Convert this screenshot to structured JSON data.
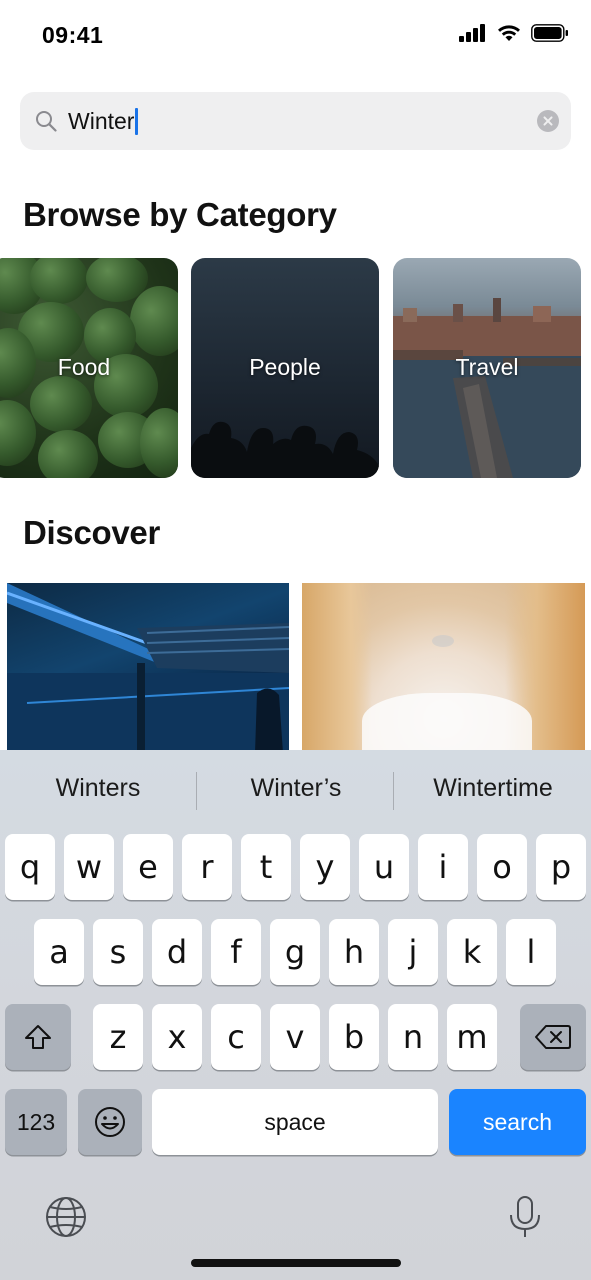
{
  "status_bar": {
    "time": "09:41",
    "icons": [
      "cellular-signal-icon",
      "wifi-icon",
      "battery-icon"
    ]
  },
  "search": {
    "value": "Winter",
    "icon": "search-icon",
    "clear_icon": "clear-icon"
  },
  "browse": {
    "title": "Browse by Category",
    "categories": [
      {
        "label": "Food"
      },
      {
        "label": "People"
      },
      {
        "label": "Travel"
      }
    ]
  },
  "discover": {
    "title": "Discover"
  },
  "keyboard": {
    "suggestions": [
      "Winters",
      "Winter’s",
      "Wintertime"
    ],
    "row1": [
      "q",
      "w",
      "e",
      "r",
      "t",
      "y",
      "u",
      "i",
      "o",
      "p"
    ],
    "row2": [
      "a",
      "s",
      "d",
      "f",
      "g",
      "h",
      "j",
      "k",
      "l"
    ],
    "row3": [
      "z",
      "x",
      "c",
      "v",
      "b",
      "n",
      "m"
    ],
    "numbers_key": "123",
    "space_key": "space",
    "search_key": "search",
    "shift_icon": "shift-icon",
    "delete_icon": "delete-icon",
    "emoji_icon": "emoji-icon",
    "globe_icon": "globe-icon",
    "mic_icon": "microphone-icon",
    "accent_color": "#1a84ff"
  }
}
